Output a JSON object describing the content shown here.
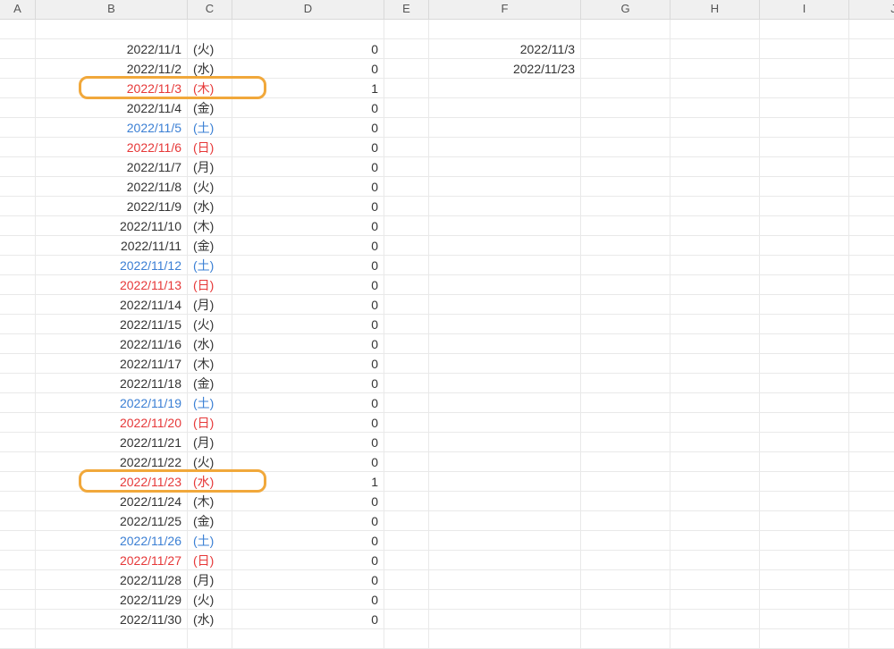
{
  "columns": [
    "A",
    "B",
    "C",
    "D",
    "E",
    "F",
    "G",
    "H",
    "I",
    "J"
  ],
  "f_values": [
    "2022/11/3",
    "2022/11/23"
  ],
  "highlight_rows": [
    3,
    23
  ],
  "colors": {
    "red": "#e63838",
    "blue": "#3a7fd4",
    "highlight": "#f1a83b"
  },
  "rows": [
    {
      "date": "2022/11/1",
      "wd": "(火)",
      "d": "0",
      "cls": ""
    },
    {
      "date": "2022/11/2",
      "wd": "(水)",
      "d": "0",
      "cls": ""
    },
    {
      "date": "2022/11/3",
      "wd": "(木)",
      "d": "1",
      "cls": "red"
    },
    {
      "date": "2022/11/4",
      "wd": "(金)",
      "d": "0",
      "cls": ""
    },
    {
      "date": "2022/11/5",
      "wd": "(土)",
      "d": "0",
      "cls": "blue"
    },
    {
      "date": "2022/11/6",
      "wd": "(日)",
      "d": "0",
      "cls": "red"
    },
    {
      "date": "2022/11/7",
      "wd": "(月)",
      "d": "0",
      "cls": ""
    },
    {
      "date": "2022/11/8",
      "wd": "(火)",
      "d": "0",
      "cls": ""
    },
    {
      "date": "2022/11/9",
      "wd": "(水)",
      "d": "0",
      "cls": ""
    },
    {
      "date": "2022/11/10",
      "wd": "(木)",
      "d": "0",
      "cls": ""
    },
    {
      "date": "2022/11/11",
      "wd": "(金)",
      "d": "0",
      "cls": ""
    },
    {
      "date": "2022/11/12",
      "wd": "(土)",
      "d": "0",
      "cls": "blue"
    },
    {
      "date": "2022/11/13",
      "wd": "(日)",
      "d": "0",
      "cls": "red"
    },
    {
      "date": "2022/11/14",
      "wd": "(月)",
      "d": "0",
      "cls": ""
    },
    {
      "date": "2022/11/15",
      "wd": "(火)",
      "d": "0",
      "cls": ""
    },
    {
      "date": "2022/11/16",
      "wd": "(水)",
      "d": "0",
      "cls": ""
    },
    {
      "date": "2022/11/17",
      "wd": "(木)",
      "d": "0",
      "cls": ""
    },
    {
      "date": "2022/11/18",
      "wd": "(金)",
      "d": "0",
      "cls": ""
    },
    {
      "date": "2022/11/19",
      "wd": "(土)",
      "d": "0",
      "cls": "blue"
    },
    {
      "date": "2022/11/20",
      "wd": "(日)",
      "d": "0",
      "cls": "red"
    },
    {
      "date": "2022/11/21",
      "wd": "(月)",
      "d": "0",
      "cls": ""
    },
    {
      "date": "2022/11/22",
      "wd": "(火)",
      "d": "0",
      "cls": ""
    },
    {
      "date": "2022/11/23",
      "wd": "(水)",
      "d": "1",
      "cls": "red"
    },
    {
      "date": "2022/11/24",
      "wd": "(木)",
      "d": "0",
      "cls": ""
    },
    {
      "date": "2022/11/25",
      "wd": "(金)",
      "d": "0",
      "cls": ""
    },
    {
      "date": "2022/11/26",
      "wd": "(土)",
      "d": "0",
      "cls": "blue"
    },
    {
      "date": "2022/11/27",
      "wd": "(日)",
      "d": "0",
      "cls": "red"
    },
    {
      "date": "2022/11/28",
      "wd": "(月)",
      "d": "0",
      "cls": ""
    },
    {
      "date": "2022/11/29",
      "wd": "(火)",
      "d": "0",
      "cls": ""
    },
    {
      "date": "2022/11/30",
      "wd": "(水)",
      "d": "0",
      "cls": ""
    }
  ]
}
